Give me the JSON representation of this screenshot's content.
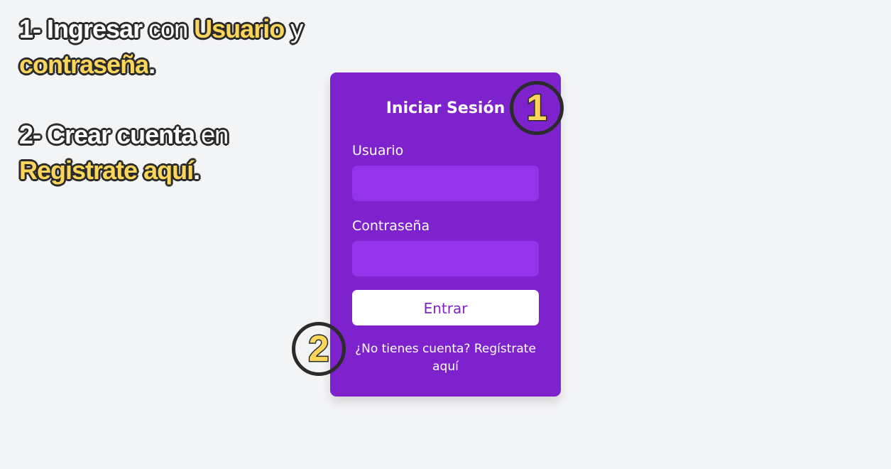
{
  "instructions": {
    "step1_prefix": "1- Ingresar",
    "step1_con": "con",
    "step1_usuario": "Usuario",
    "step1_y": "y",
    "step1_contrasena": "contraseña",
    "step1_dot": ".",
    "step2_prefix": "2- Crear cuenta",
    "step2_en": "en",
    "step2_link": "Registrate aquí",
    "step2_dot": "."
  },
  "login_card": {
    "title": "Iniciar Sesión",
    "username_label": "Usuario",
    "username_value": "",
    "password_label": "Contraseña",
    "password_value": "",
    "submit_label": "Entrar",
    "register_prompt": "¿No tienes cuenta? Regístrate aquí"
  },
  "markers": {
    "first": "1",
    "second": "2"
  },
  "colors": {
    "background": "#f3f4f6",
    "card": "#7e22ce",
    "input": "#9333ea",
    "highlight": "#fbd65a",
    "outline": "#2b2b2b"
  }
}
